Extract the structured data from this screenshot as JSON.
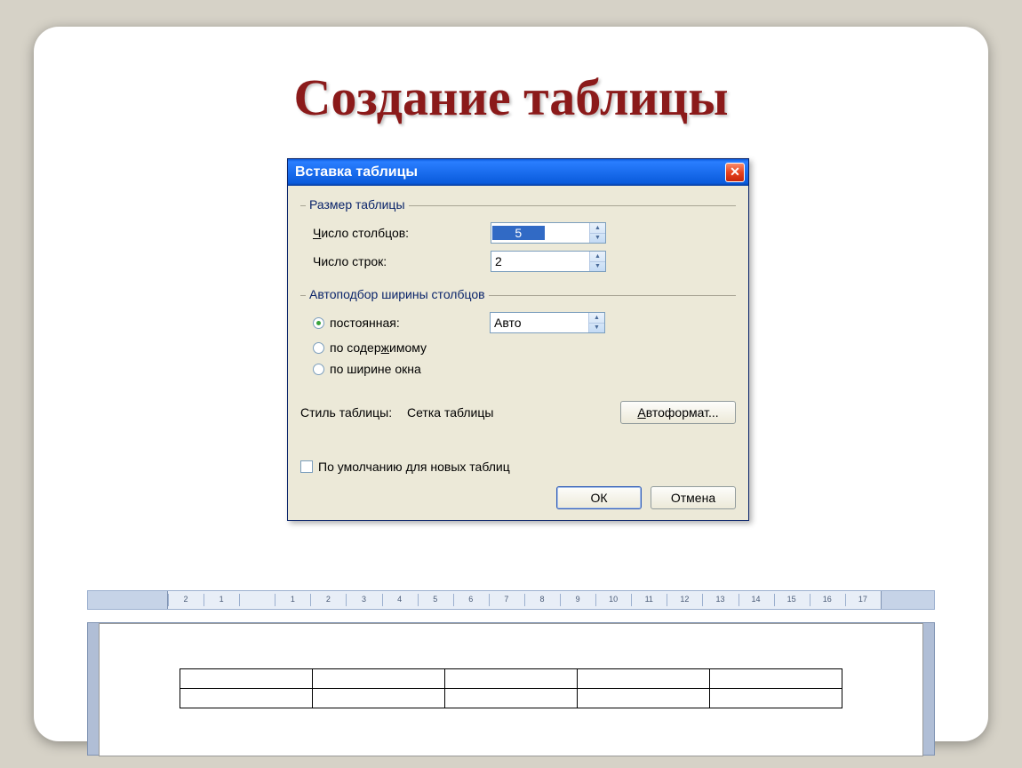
{
  "slide": {
    "title": "Создание таблицы"
  },
  "dialog": {
    "title": "Вставка таблицы",
    "close": "✕",
    "group_size": "Размер таблицы",
    "columns_label_pre": "",
    "columns_key": "Ч",
    "columns_label_post": "исло столбцов:",
    "columns_value": "5",
    "rows_label": "Число строк:",
    "rows_value": "2",
    "group_autofit": "Автоподбор ширины столбцов",
    "opt_fixed": "постоянная:",
    "fixed_value": "Авто",
    "opt_content_pre": "по содер",
    "opt_content_key": "ж",
    "opt_content_post": "имому",
    "opt_window": "по ширине окна",
    "style_label": "Стиль таблицы:",
    "style_value": "Сетка таблицы",
    "autoformat_pre": "",
    "autoformat_key": "А",
    "autoformat_post": "втоформат...",
    "default_label": "По умолчанию для новых таблиц",
    "ok": "ОК",
    "cancel": "Отмена"
  },
  "ruler": {
    "marks": [
      "2",
      "1",
      "",
      "1",
      "2",
      "3",
      "4",
      "5",
      "6",
      "7",
      "8",
      "9",
      "10",
      "11",
      "12",
      "13",
      "14",
      "15",
      "16",
      "17"
    ]
  },
  "table": {
    "rows": 2,
    "cols": 5
  }
}
